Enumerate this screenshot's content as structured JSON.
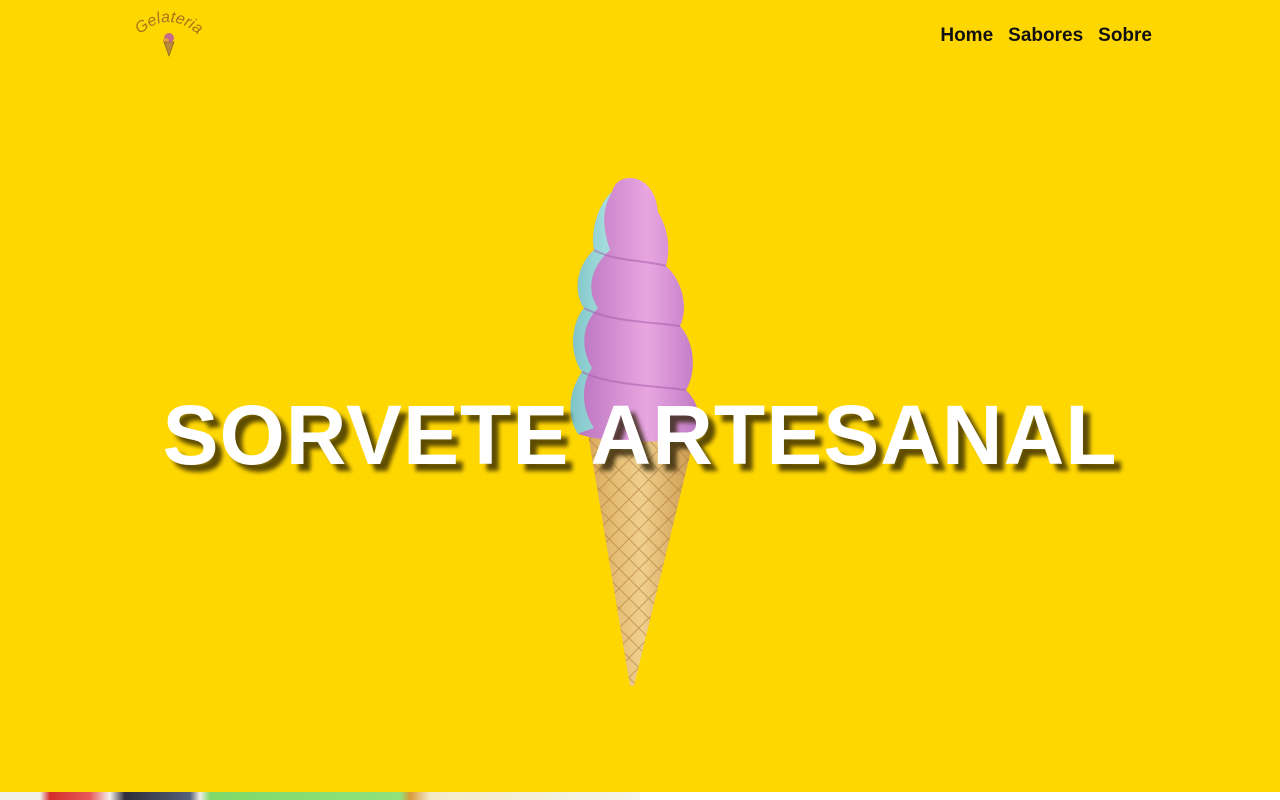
{
  "header": {
    "logo_text": "Gelateria",
    "nav": [
      {
        "label": "Home"
      },
      {
        "label": "Sabores"
      },
      {
        "label": "Sobre"
      }
    ]
  },
  "hero": {
    "title": "SORVETE ARTESANAL",
    "image_icon": "ice-cream-cone"
  },
  "colors": {
    "background": "#ffd700",
    "title": "#ffffff",
    "nav_text": "#111111",
    "logo": "#a8741a"
  }
}
